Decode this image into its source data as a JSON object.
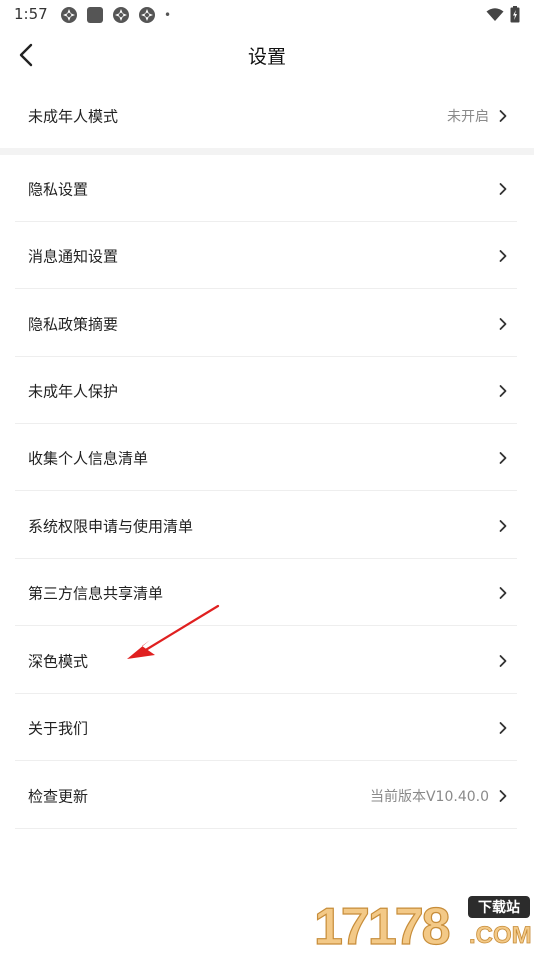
{
  "status_bar": {
    "time": "1:57",
    "notification_icons": [
      "app-notification-icon",
      "square-notification-icon",
      "app-notification-icon",
      "app-notification-icon"
    ],
    "dot": "•",
    "right_icons": [
      "wifi-icon",
      "battery-charging-icon"
    ]
  },
  "header": {
    "title": "设置",
    "back_icon": "chevron-left-icon"
  },
  "minor_mode": {
    "label": "未成年人模式",
    "value": "未开启"
  },
  "settings_list": [
    {
      "label": "隐私设置"
    },
    {
      "label": "消息通知设置"
    },
    {
      "label": "隐私政策摘要"
    },
    {
      "label": "未成年人保护"
    },
    {
      "label": "收集个人信息清单"
    },
    {
      "label": "系统权限申请与使用清单"
    },
    {
      "label": "第三方信息共享清单"
    },
    {
      "label": "深色模式"
    },
    {
      "label": "关于我们"
    },
    {
      "label": "检查更新",
      "value": "当前版本V10.40.0"
    }
  ],
  "annotation": {
    "arrow_color": "#e02020"
  },
  "watermark": {
    "digits": "17178",
    "badge": "下载站",
    "domain": ".COM"
  },
  "colors": {
    "text_primary": "#222222",
    "text_secondary": "#8a8a8a",
    "divider": "#eeeeee",
    "section_gap": "#f3f3f3"
  }
}
